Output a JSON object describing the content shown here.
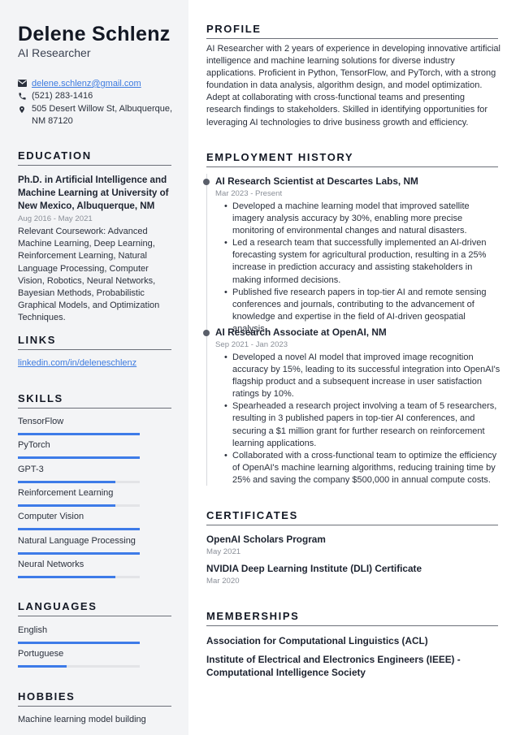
{
  "header": {
    "name": "Delene Schlenz",
    "role": "AI Researcher"
  },
  "contact": {
    "email": "delene.schlenz@gmail.com",
    "phone": "(521) 283-1416",
    "address": "505 Desert Willow St, Albuquerque, NM 87120",
    "icons": [
      "envelope-icon",
      "phone-icon",
      "map-pin-icon"
    ]
  },
  "education": {
    "heading": "EDUCATION",
    "title": "Ph.D. in Artificial Intelligence and Machine Learning at University of New Mexico, Albuquerque, NM",
    "date": "Aug 2016 - May 2021",
    "description": "Relevant Coursework: Advanced Machine Learning, Deep Learning, Reinforcement Learning, Natural Language Processing, Computer Vision, Robotics, Neural Networks, Bayesian Methods, Probabilistic Graphical Models, and Optimization Techniques."
  },
  "links": {
    "heading": "LINKS",
    "items": [
      "linkedin.com/in/deleneschlenz"
    ]
  },
  "skills": {
    "heading": "SKILLS",
    "items": [
      {
        "label": "TensorFlow",
        "level": 1.0
      },
      {
        "label": "PyTorch",
        "level": 1.0
      },
      {
        "label": "GPT-3",
        "level": 0.8
      },
      {
        "label": "Reinforcement Learning",
        "level": 0.8
      },
      {
        "label": "Computer Vision",
        "level": 1.0
      },
      {
        "label": "Natural Language Processing",
        "level": 1.0
      },
      {
        "label": "Neural Networks",
        "level": 0.8
      }
    ]
  },
  "languages": {
    "heading": "LANGUAGES",
    "items": [
      {
        "label": "English",
        "level": 1.0
      },
      {
        "label": "Portuguese",
        "level": 0.4
      }
    ]
  },
  "hobbies": {
    "heading": "HOBBIES",
    "items": [
      "Machine learning model building"
    ]
  },
  "profile": {
    "heading": "PROFILE",
    "text": "AI Researcher with 2 years of experience in developing innovative artificial intelligence and machine learning solutions for diverse industry applications. Proficient in Python, TensorFlow, and PyTorch, with a strong foundation in data analysis, algorithm design, and model optimization. Adept at collaborating with cross-functional teams and presenting research findings to stakeholders. Skilled in identifying opportunities for leveraging AI technologies to drive business growth and efficiency."
  },
  "employment": {
    "heading": "EMPLOYMENT HISTORY",
    "jobs": [
      {
        "title": "AI Research Scientist at Descartes Labs, NM",
        "date": "Mar 2023 - Present",
        "bullets": [
          "Developed a machine learning model that improved satellite imagery analysis accuracy by 30%, enabling more precise monitoring of environmental changes and natural disasters.",
          "Led a research team that successfully implemented an AI-driven forecasting system for agricultural production, resulting in a 25% increase in prediction accuracy and assisting stakeholders in making informed decisions.",
          "Published five research papers in top-tier AI and remote sensing conferences and journals, contributing to the advancement of knowledge and expertise in the field of AI-driven geospatial analysis."
        ]
      },
      {
        "title": "AI Research Associate at OpenAI, NM",
        "date": "Sep 2021 - Jan 2023",
        "bullets": [
          "Developed a novel AI model that improved image recognition accuracy by 15%, leading to its successful integration into OpenAI's flagship product and a subsequent increase in user satisfaction ratings by 10%.",
          "Spearheaded a research project involving a team of 5 researchers, resulting in 3 published papers in top-tier AI conferences, and securing a $1 million grant for further research on reinforcement learning applications.",
          "Collaborated with a cross-functional team to optimize the efficiency of OpenAI's machine learning algorithms, reducing training time by 25% and saving the company $500,000 in annual compute costs."
        ]
      }
    ]
  },
  "certificates": {
    "heading": "CERTIFICATES",
    "items": [
      {
        "title": "OpenAI Scholars Program",
        "date": "May 2021"
      },
      {
        "title": "NVIDIA Deep Learning Institute (DLI) Certificate",
        "date": "Mar 2020"
      }
    ]
  },
  "memberships": {
    "heading": "MEMBERSHIPS",
    "items": [
      "Association for Computational Linguistics (ACL)",
      "Institute of Electrical and Electronics Engineers (IEEE) - Computational Intelligence Society"
    ]
  },
  "colors": {
    "accent": "#3d7be8",
    "sidebar_bg": "#f3f4f6",
    "link": "#3d7be0"
  }
}
